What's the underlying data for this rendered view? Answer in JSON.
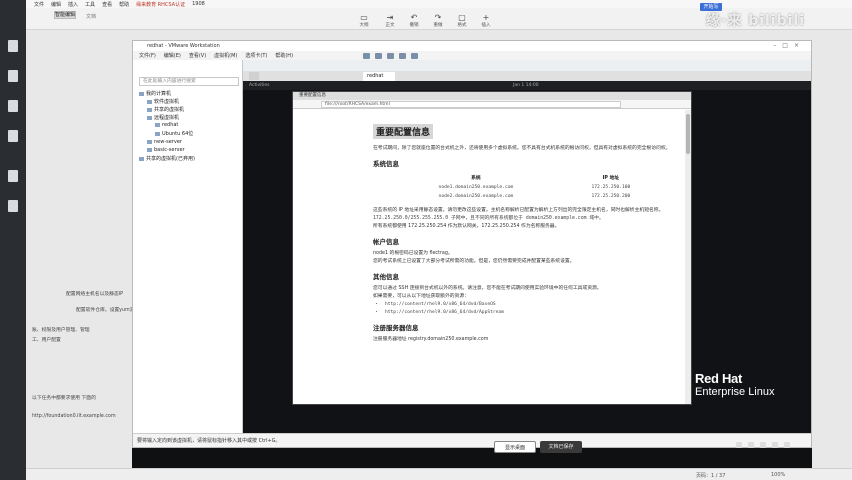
{
  "editor": {
    "menu": [
      "文件",
      "编辑",
      "插入",
      "工具",
      "查看",
      "帮助"
    ],
    "active_tab": "缘来教育 RHCSA认证",
    "tab_suffix": "1908",
    "ribbon_tab_label": "智能编辑",
    "ribbon_tab_name": "文档",
    "ribbon_tools": [
      {
        "icon": "▭",
        "label": "大纲"
      },
      {
        "icon": "⇥",
        "label": "正文"
      },
      {
        "icon": "↶",
        "label": "撤销"
      },
      {
        "icon": "↷",
        "label": "重做"
      },
      {
        "icon": "▢",
        "label": "格式"
      },
      {
        "icon": "+",
        "label": "插入"
      }
    ],
    "top_badge": "开始写",
    "watermark": "缘·来 bilibili",
    "side_notes": [
      "配置网络主机名以及静态IP",
      "配置软件仓库，设置yum源",
      "账、权限及用户管理、管理",
      "工、用户配置",
      "以下任务中都要求使用 下面的",
      "http://foundation0.ilt.example.com"
    ],
    "status_page": "页码：1 / 37",
    "status_zoom": "100%"
  },
  "vmware": {
    "title": "redhat - VMware Workstation",
    "menu": [
      "文件(F)",
      "编辑(E)",
      "查看(V)",
      "虚拟机(M)",
      "选项卡(T)",
      "帮助(H)"
    ],
    "library_search": "在此处输入内容进行搜索",
    "library_tree": [
      "我的计算机",
      "软件虚拟机",
      "共享的虚拟机",
      "远程虚拟机",
      "redhat",
      "Ubuntu 64位",
      "new-server",
      "basic-server",
      "共享的虚拟机(已弃用)"
    ],
    "vm_tab": "redhat",
    "guest_activities": "Activities",
    "guest_clock": "Jan 1 14:00",
    "statusbar": "要将输入定向到该虚拟机，请将鼠标指针移入其中或按 Ctrl+G。",
    "taskbar_btn1": "显示桌面",
    "taskbar_btn2": "文档已保存",
    "logo_line1": "Red Hat",
    "logo_line2": "Enterprise Linux"
  },
  "browser": {
    "tab_title": "重要配置信息",
    "url": "file:///root/RHCSA/exam.html",
    "doc": {
      "title": "重要配置信息",
      "intro": "在考试期间，除了您就座位置的台式机之外，还将使用多个虚拟系统。您不具有台式机系统的根访问权，但具有对虚拟系统的完全根访问权。",
      "h_system": "系统信息",
      "col_system": "系统",
      "col_ip": "IP 地址",
      "rows": [
        {
          "system": "node1.domain250.example.com",
          "ip": "172.25.250.100"
        },
        {
          "system": "node2.domain250.example.com",
          "ip": "172.25.250.200"
        }
      ],
      "p_domain": "这些系统的 IP 地址采用静态设置。请勿更改这些设置。主机名称解析已配置为解析上方列出的完全限定主机名，同时也解析主机短名称。",
      "p_domain2": "172.25.250.0/255.255.255.0 子网中，且不同的所有系统都位于 domain250.example.com 域中。",
      "p_gateway": "所有系统都使用 172.25.250.254 作为默认网关，172.25.250.254 作为名称服务器。",
      "h_account": "帐户信息",
      "p_account": "node1 的根密码已设置为 flectrag。",
      "p_account2": "您的考试系统上已设置了大部分考试所需的功能。但是，您仍然需要完成并配置某些系统设置。",
      "h_other": "其他信息",
      "p_other": "您可以通过 SSH 连接到台式机以外的系统。请注意，您不能在考试期间使用实验环境中的任何工具或资源。",
      "p_other2": "如果需要，可以从以下地址获取额外的资源：",
      "urls": [
        "http://content/rhel9.0/x86_64/dvd/BaseOS",
        "http://content/rhel9.0/x86_64/dvd/AppStream"
      ],
      "h_registry": "注册服务器信息",
      "p_registry": "注册服务器地址 registry.domain250.example.com"
    }
  }
}
